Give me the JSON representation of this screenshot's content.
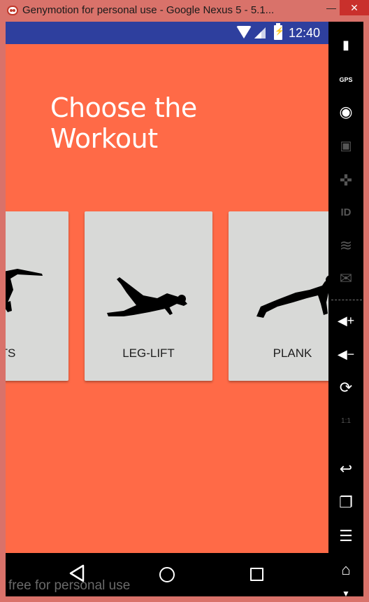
{
  "window": {
    "title": "Genymotion for personal use - Google Nexus 5 - 5.1...",
    "minimize_label": "—",
    "maximize_label": "□",
    "close_label": "✕"
  },
  "statusbar": {
    "time": "12:40",
    "icons": [
      "wifi-icon",
      "signal-icon",
      "battery-charging-icon"
    ]
  },
  "page": {
    "title": "Choose the Workout"
  },
  "workouts": [
    {
      "label": "ATS",
      "icon": "squats-silhouette-icon"
    },
    {
      "label": "LEG-LIFT",
      "icon": "leg-lift-silhouette-icon"
    },
    {
      "label": "PLANK",
      "icon": "plank-silhouette-icon"
    }
  ],
  "navbar": {
    "icons": [
      "back-icon",
      "home-icon",
      "recent-apps-icon"
    ],
    "watermark": "free for personal use"
  },
  "sidebar": {
    "tools": [
      {
        "icon": "battery-icon",
        "glyph": "🔋",
        "enabled": true
      },
      {
        "icon": "gps-icon",
        "glyph": "GPS",
        "enabled": true
      },
      {
        "icon": "webcam-icon",
        "glyph": "◉",
        "enabled": true
      },
      {
        "icon": "screencast-icon",
        "glyph": "🎬",
        "enabled": false
      },
      {
        "icon": "dpad-icon",
        "glyph": "✜",
        "enabled": false
      },
      {
        "icon": "device-id-icon",
        "glyph": "ID",
        "enabled": false
      },
      {
        "icon": "network-icon",
        "glyph": ")",
        "enabled": false
      },
      {
        "icon": "sms-icon",
        "glyph": "…",
        "enabled": false
      },
      {
        "icon": "volume-up-icon",
        "glyph": "◀+",
        "enabled": true
      },
      {
        "icon": "volume-down-icon",
        "glyph": "◀−",
        "enabled": true
      },
      {
        "icon": "rotate-icon",
        "glyph": "⟳",
        "enabled": true
      },
      {
        "icon": "pixel-perfect-icon",
        "glyph": "1:1",
        "enabled": false
      },
      {
        "icon": "back-icon",
        "glyph": "↩",
        "enabled": true
      },
      {
        "icon": "recent-apps-icon",
        "glyph": "❐",
        "enabled": true
      },
      {
        "icon": "menu-icon",
        "glyph": "☰",
        "enabled": true
      },
      {
        "icon": "home-icon",
        "glyph": "⌂",
        "enabled": true
      },
      {
        "icon": "power-icon",
        "glyph": "⏻",
        "enabled": true
      }
    ]
  },
  "colors": {
    "background": "#ff6a47",
    "statusbar": "#2e3f9e",
    "card": "#d8d9d7",
    "window_frame": "#d9726a"
  }
}
